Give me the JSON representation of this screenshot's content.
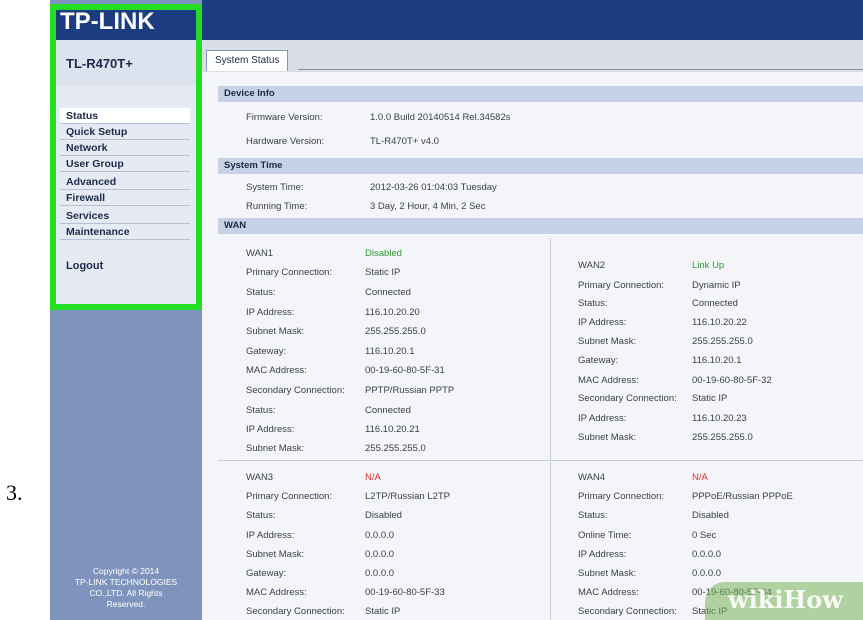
{
  "step": "3.",
  "brand": {
    "logo": "TP-LINK",
    "model": "TL-R470T+"
  },
  "menu": {
    "items": [
      {
        "label": "Status",
        "active": true
      },
      {
        "label": "Quick Setup"
      },
      {
        "label": "Network"
      },
      {
        "label": "User Group"
      },
      {
        "label": "Advanced"
      },
      {
        "label": "Firewall"
      },
      {
        "label": "Services"
      },
      {
        "label": "Maintenance"
      }
    ],
    "logout": "Logout"
  },
  "copyright": [
    "Copyright © 2014",
    "TP-LINK TECHNOLOGIES",
    "CO.,LTD. All Rights",
    "Reserved."
  ],
  "tab": "System Status",
  "sections": {
    "device_info": "Device Info",
    "system_time": "System Time",
    "wan": "WAN"
  },
  "device_info": {
    "firmware_label": "Firmware Version:",
    "firmware_value": "1.0.0 Build 20140514 Rel.34582s",
    "hardware_label": "Hardware Version:",
    "hardware_value": "TL-R470T+ v4.0"
  },
  "system_time": {
    "time_label": "System Time:",
    "time_value": "2012-03-26 01:04:03 Tuesday",
    "running_label": "Running Time:",
    "running_value": "3 Day, 2 Hour, 4 Min, 2 Sec"
  },
  "wan1": {
    "name": "WAN1",
    "state": "Disabled",
    "rows": [
      [
        "Primary Connection:",
        "Static IP"
      ],
      [
        "Status:",
        "Connected"
      ],
      [
        "IP Address:",
        "116.10.20.20"
      ],
      [
        "Subnet Mask:",
        "255.255.255.0"
      ],
      [
        "Gateway:",
        "116.10.20.1"
      ],
      [
        "MAC Address:",
        "00-19-60-80-5F-31"
      ],
      [
        "Secondary Connection:",
        "PPTP/Russian PPTP"
      ],
      [
        "Status:",
        "Connected"
      ],
      [
        "IP Address:",
        "116.10.20.21"
      ],
      [
        "Subnet Mask:",
        "255.255.255.0"
      ]
    ]
  },
  "wan2": {
    "name": "WAN2",
    "state": "Link Up",
    "rows": [
      [
        "Primary Connection:",
        "Dynamic IP"
      ],
      [
        "Status:",
        "Connected"
      ],
      [
        "IP Address:",
        "116.10.20.22"
      ],
      [
        "Subnet Mask:",
        "255.255.255.0"
      ],
      [
        "Gateway:",
        "116.10.20.1"
      ],
      [
        "MAC Address:",
        "00-19-60-80-5F-32"
      ],
      [
        "Secondary Connection:",
        "Static IP"
      ],
      [
        "IP Address:",
        "116.10.20.23"
      ],
      [
        "Subnet Mask:",
        "255.255.255.0"
      ]
    ]
  },
  "wan3": {
    "name": "WAN3",
    "state": "N/A",
    "rows": [
      [
        "Primary Connection:",
        "L2TP/Russian L2TP"
      ],
      [
        "Status:",
        "Disabled"
      ],
      [
        "IP Address:",
        "0.0.0.0"
      ],
      [
        "Subnet Mask:",
        "0.0.0.0"
      ],
      [
        "Gateway:",
        "0.0.0.0"
      ],
      [
        "MAC Address:",
        "00-19-60-80-5F-33"
      ],
      [
        "Secondary Connection:",
        "Static IP"
      ]
    ]
  },
  "wan4": {
    "name": "WAN4",
    "state": "N/A",
    "rows": [
      [
        "Primary Connection:",
        "PPPoE/Russian PPPoE"
      ],
      [
        "Status:",
        "Disabled"
      ],
      [
        "Online Time:",
        "0 Sec"
      ],
      [
        "IP Address:",
        "0.0.0.0"
      ],
      [
        "Subnet Mask:",
        "0.0.0.0"
      ],
      [
        "MAC Address:",
        "00-19-60-80-5F-34"
      ],
      [
        "Secondary Connection:",
        "Static IP"
      ]
    ]
  },
  "watermark": "wikiHow",
  "colors": {
    "highlight": "#22dd22",
    "header": "#1b3c80",
    "sidebar": "#7f94bc"
  }
}
